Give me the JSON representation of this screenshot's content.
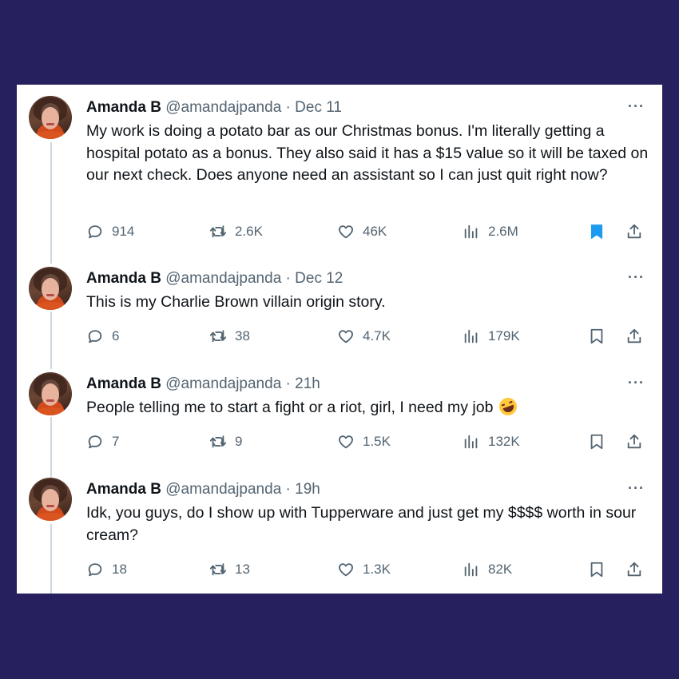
{
  "colors": {
    "background": "#26215e",
    "card": "#ffffff",
    "text_primary": "#0f1419",
    "text_secondary": "#536471",
    "bookmark_active": "#1d9bf0"
  },
  "tweets": [
    {
      "name": "Amanda B",
      "handle": "@amandajpanda",
      "time": "· Dec 11",
      "text": "My work is doing a potato bar as our Christmas bonus. I'm literally getting a hospital potato as a bonus. They also said it has a $15 value so it will be taxed on our next check. Does anyone need an assistant so I can just quit right now?",
      "emoji": "",
      "replies": "914",
      "retweets": "2.6K",
      "likes": "46K",
      "views": "2.6M",
      "bookmarked": true
    },
    {
      "name": "Amanda B",
      "handle": "@amandajpanda",
      "time": "· Dec 12",
      "text": "This is my Charlie Brown villain origin story.",
      "emoji": "",
      "replies": "6",
      "retweets": "38",
      "likes": "4.7K",
      "views": "179K",
      "bookmarked": false
    },
    {
      "name": "Amanda B",
      "handle": "@amandajpanda",
      "time": "· 21h",
      "text": "People telling me to start a fight or a riot, girl, I need my job",
      "emoji": "rolling-on-floor-laughing",
      "replies": "7",
      "retweets": "9",
      "likes": "1.5K",
      "views": "132K",
      "bookmarked": false
    },
    {
      "name": "Amanda B",
      "handle": "@amandajpanda",
      "time": "· 19h",
      "text": "Idk, you guys, do I show up with Tupperware and just get my $$$$ worth in sour cream?",
      "emoji": "",
      "replies": "18",
      "retweets": "13",
      "likes": "1.3K",
      "views": "82K",
      "bookmarked": false
    }
  ]
}
